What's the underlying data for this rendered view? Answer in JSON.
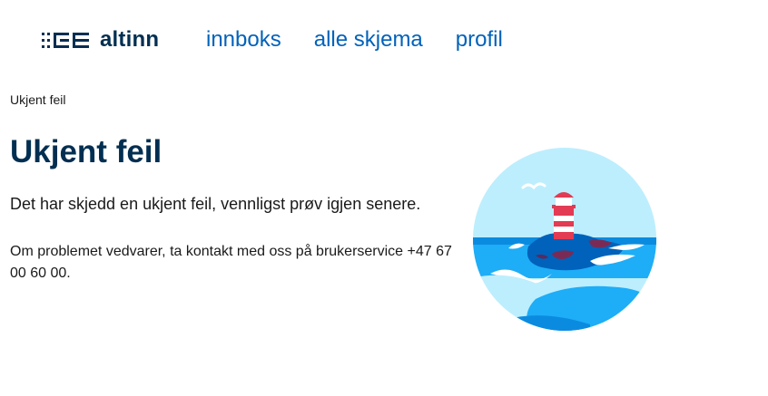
{
  "header": {
    "logo_text": "altinn",
    "nav": [
      {
        "label": "innboks"
      },
      {
        "label": "alle skjema"
      },
      {
        "label": "profil"
      }
    ]
  },
  "breadcrumb": "Ukjent feil",
  "main": {
    "title": "Ukjent feil",
    "lead": "Det har skjedd en ukjent feil, vennligst prøv igjen senere.",
    "body": "Om problemet vedvarer, ta kontakt med oss på brukerservice +47 67 00 60 00."
  },
  "icons": {
    "logo": "altinn-logo-icon",
    "illustration": "lighthouse-illustration"
  },
  "colors": {
    "brand_dark": "#022f51",
    "link": "#0062ba",
    "sky": "#bdeefd",
    "sea": "#1eadf7",
    "sea_dark": "#0062ba",
    "lighthouse_red": "#e23b53"
  }
}
